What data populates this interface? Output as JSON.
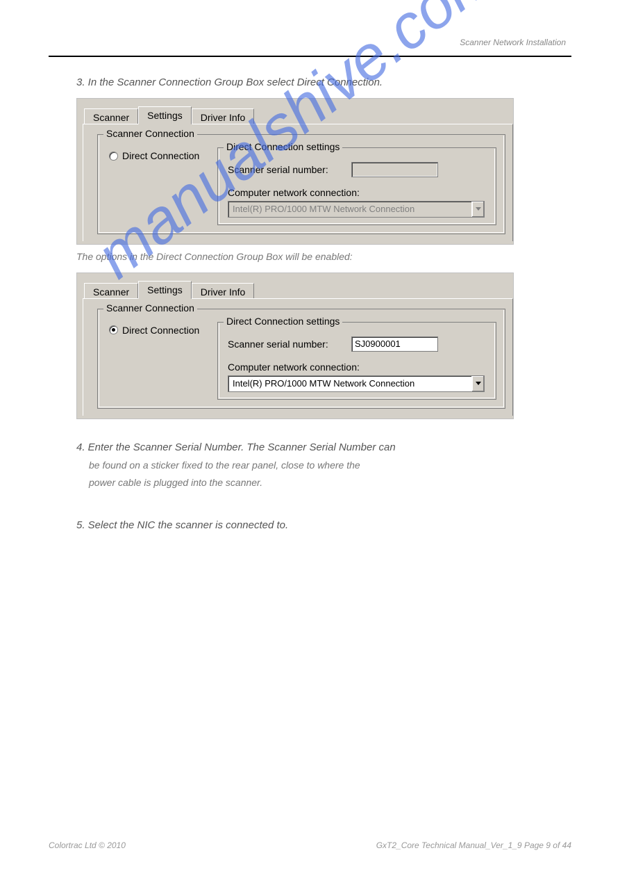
{
  "header": {
    "title": "Scanner Network Installation"
  },
  "steps": {
    "s3": "3. In the Scanner Connection Group Box select Direct Connection.",
    "s3sub": "The options in the Direct Connection Group Box will be enabled:",
    "s4a": "4. Enter the Scanner Serial Number. The Scanner Serial Number can",
    "s4b": "be found on a sticker fixed to the rear panel, close to where the",
    "s4c": "power cable is plugged into the scanner.",
    "s5": "5. Select the NIC the scanner is connected to."
  },
  "tabs": {
    "t1": "Scanner",
    "t2": "Settings",
    "t3": "Driver Info"
  },
  "panel1": {
    "group_label": "Scanner Connection",
    "radio_label": "Direct  Connection",
    "inner_group_label": "Direct Connection settings",
    "serial_label": "Scanner serial number:",
    "serial_value": "",
    "net_label": "Computer network connection:",
    "net_value": "Intel(R) PRO/1000 MTW Network Connection"
  },
  "panel2": {
    "group_label": "Scanner Connection",
    "radio_label": "Direct  Connection",
    "inner_group_label": "Direct Connection settings",
    "serial_label": "Scanner serial number:",
    "serial_value": "SJ0900001",
    "net_label": "Computer network connection:",
    "net_value": "Intel(R) PRO/1000 MTW Network Connection"
  },
  "watermark": "manualshive.com",
  "footer": {
    "left": "Colortrac Ltd © 2010",
    "right": "GxT2_Core Technical Manual_Ver_1_9                      Page 9 of 44"
  }
}
